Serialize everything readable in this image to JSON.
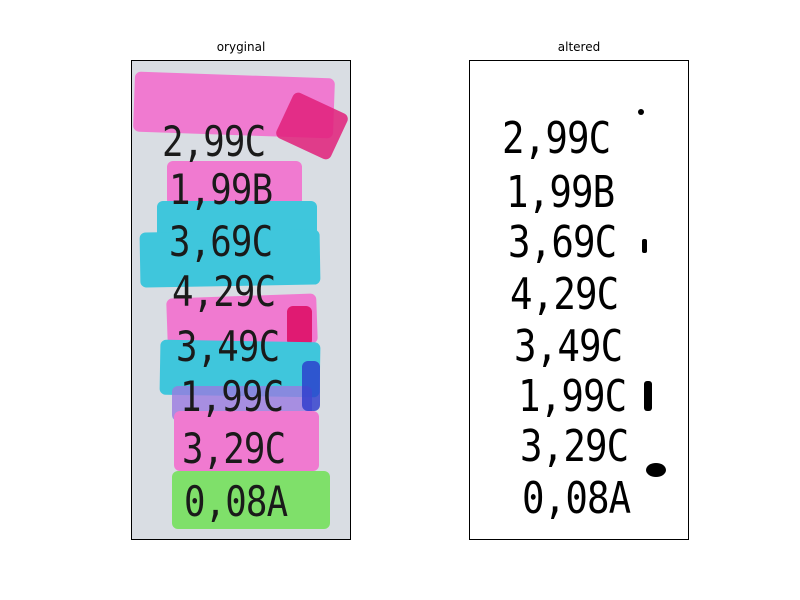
{
  "figure": {
    "left_title": "oryginal",
    "right_title": "altered"
  },
  "labels": [
    "2,99C",
    "1,99B",
    "3,69C",
    "4,29C",
    "3,49C",
    "1,99C",
    "3,29C",
    "0,08A"
  ],
  "strip_colors": [
    "#f07ad0",
    "#f07ad0",
    "#3fc6dc",
    "#3fc6dc",
    "#f07ad0",
    "#3fc6dc",
    "#f07ad0",
    "#7fe06a"
  ]
}
